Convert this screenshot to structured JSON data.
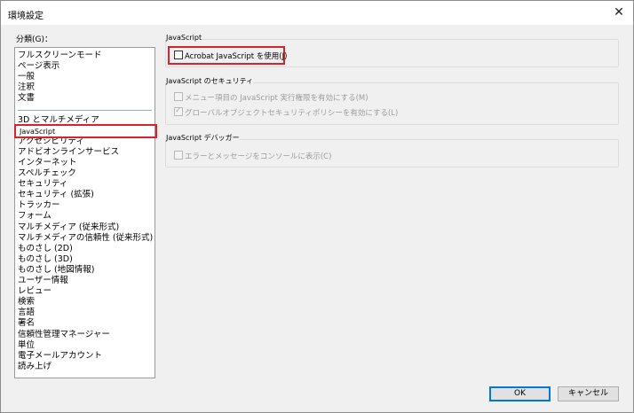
{
  "window": {
    "title": "環境設定",
    "close_glyph": "✕"
  },
  "sidebar": {
    "heading": "分類(G)：",
    "items_top": [
      "フルスクリーンモード",
      "ページ表示",
      "一般",
      "注釈",
      "文書"
    ],
    "items": [
      "3D とマルチメディア",
      "JavaScript",
      "アクセシビリティ",
      "アドビオンラインサービス",
      "インターネット",
      "スペルチェック",
      "セキュリティ",
      "セキュリティ (拡張)",
      "トラッカー",
      "フォーム",
      "マルチメディア (従来形式)",
      "マルチメディアの信頼性 (従来形式)",
      "ものさし (2D)",
      "ものさし (3D)",
      "ものさし (地図情報)",
      "ユーザー情報",
      "レビュー",
      "検索",
      "言語",
      "署名",
      "信頼性管理マネージャー",
      "単位",
      "電子メールアカウント",
      "読み上げ"
    ],
    "selected": "JavaScript"
  },
  "main": {
    "group_js": {
      "title": "JavaScript",
      "enable_label": "Acrobat JavaScript を使用(J)",
      "enable_checked": false
    },
    "group_security": {
      "title": "JavaScript のセキュリティ",
      "menu_label": "メニュー項目の JavaScript 実行権限を有効にする(M)",
      "menu_checked": false,
      "global_label": "グローバルオブジェクトセキュリティポリシーを有効にする(L)",
      "global_checked": true
    },
    "group_debugger": {
      "title": "JavaScript デバッガー",
      "console_label": "エラーとメッセージをコンソールに表示(C)",
      "console_checked": false
    }
  },
  "footer": {
    "ok_label": "OK",
    "cancel_label": "キャンセル"
  },
  "colors": {
    "highlight_outline": "#d9232a",
    "default_button_border": "#0078d7"
  }
}
